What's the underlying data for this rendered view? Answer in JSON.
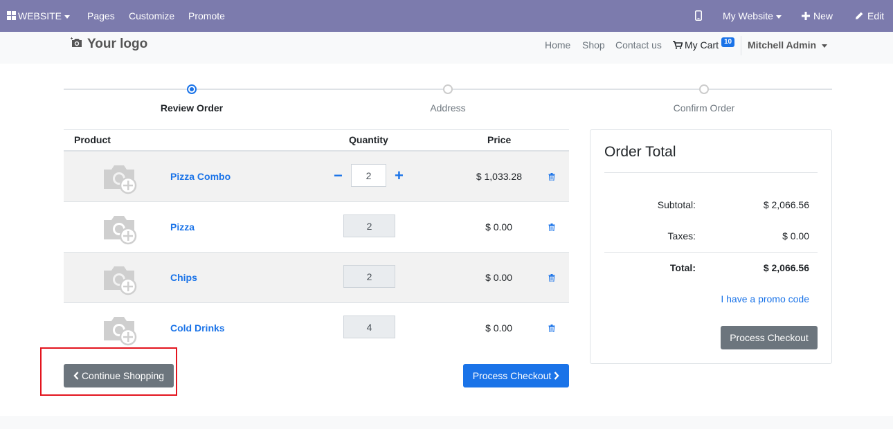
{
  "topbar": {
    "website_label": "WEBSITE",
    "pages_label": "Pages",
    "customize_label": "Customize",
    "promote_label": "Promote",
    "mobile_icon": "mobile-icon",
    "my_website_label": "My Website",
    "new_label": "New",
    "edit_label": "Edit",
    "bg_color": "#7c7bad"
  },
  "navbar": {
    "logo_text": "Your logo",
    "links": [
      "Home",
      "Shop",
      "Contact us"
    ],
    "cart_label": "My Cart",
    "cart_count": "10",
    "user_label": "Mitchell Admin"
  },
  "steps": [
    {
      "label": "Review Order",
      "active": true
    },
    {
      "label": "Address",
      "active": false
    },
    {
      "label": "Confirm Order",
      "active": false
    }
  ],
  "table": {
    "headers": {
      "product": "Product",
      "quantity": "Quantity",
      "price": "Price"
    },
    "rows": [
      {
        "name": "Pizza Combo",
        "qty": "2",
        "price": "$ 1,033.28",
        "editable": true
      },
      {
        "name": "Pizza",
        "qty": "2",
        "price": "$ 0.00",
        "editable": false
      },
      {
        "name": "Chips",
        "qty": "2",
        "price": "$ 0.00",
        "editable": false
      },
      {
        "name": "Cold Drinks",
        "qty": "4",
        "price": "$ 0.00",
        "editable": false
      }
    ]
  },
  "buttons": {
    "continue_shopping": "Continue Shopping",
    "process_checkout": "Process Checkout"
  },
  "order_total": {
    "title": "Order Total",
    "subtotal_label": "Subtotal:",
    "subtotal_value": "$ 2,066.56",
    "taxes_label": "Taxes:",
    "taxes_value": "$ 0.00",
    "total_label": "Total:",
    "total_value": "$ 2,066.56",
    "promo_link": "I have a promo code",
    "checkout_label": "Process Checkout"
  },
  "colors": {
    "accent": "#1a73e8",
    "secondary": "#6c757d",
    "highlight": "#e3141e"
  }
}
